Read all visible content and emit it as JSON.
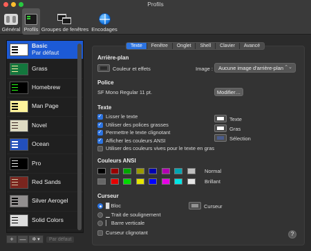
{
  "window": {
    "title": "Profils"
  },
  "toolbar": {
    "items": [
      {
        "label": "Général",
        "icon": "switch-icon"
      },
      {
        "label": "Profils",
        "icon": "terminal-icon"
      },
      {
        "label": "Groupes de fenêtres",
        "icon": "window-group-icon"
      },
      {
        "label": "Encodages",
        "icon": "globe-icon"
      }
    ]
  },
  "profiles": [
    {
      "name": "Basic",
      "subtitle": "Par défaut",
      "thumb_bg": "#ffffff",
      "thumb_fg": "#000000",
      "selected": true
    },
    {
      "name": "Grass",
      "thumb_bg": "#13773d",
      "thumb_fg": "#fff0a5"
    },
    {
      "name": "Homebrew",
      "thumb_bg": "#000000",
      "thumb_fg": "#28fe14"
    },
    {
      "name": "Man Page",
      "thumb_bg": "#fef49c",
      "thumb_fg": "#000000"
    },
    {
      "name": "Novel",
      "thumb_bg": "#dfdbc3",
      "thumb_fg": "#3b2322"
    },
    {
      "name": "Ocean",
      "thumb_bg": "#224fbc",
      "thumb_fg": "#ffffff"
    },
    {
      "name": "Pro",
      "thumb_bg": "#000000",
      "thumb_fg": "#f2f2f2"
    },
    {
      "name": "Red Sands",
      "thumb_bg": "#7a251e",
      "thumb_fg": "#d7c9a7"
    },
    {
      "name": "Silver Aerogel",
      "thumb_bg": "#928f8f",
      "thumb_fg": "#000000"
    },
    {
      "name": "Solid Colors",
      "thumb_bg": "#dddddd",
      "thumb_fg": "#000000"
    }
  ],
  "sidebar_tools": {
    "add": "+",
    "remove": "—",
    "gear": "✲ ▾",
    "default": "Par défaut"
  },
  "tabs": [
    {
      "label": "Texte",
      "active": true
    },
    {
      "label": "Fenêtre"
    },
    {
      "label": "Onglet"
    },
    {
      "label": "Shell"
    },
    {
      "label": "Clavier"
    },
    {
      "label": "Avancé"
    }
  ],
  "background": {
    "title": "Arrière-plan",
    "color_label": "Couleur et effets",
    "color": "#2b2b2b",
    "image_label": "Image :",
    "image_value": "Aucune image d'arrière-plan",
    "arrow": "⌃⌄"
  },
  "font": {
    "title": "Police",
    "value": "SF Mono Regular 11 pt.",
    "modify_label": "Modifier…"
  },
  "text": {
    "title": "Texte",
    "options": [
      {
        "label": "Lisser le texte",
        "checked": true
      },
      {
        "label": "Utiliser des polices grasses",
        "checked": true
      },
      {
        "label": "Permettre le texte clignotant",
        "checked": true
      },
      {
        "label": "Afficher les couleurs ANSI",
        "checked": true
      },
      {
        "label": "Utiliser des couleurs vives pour le texte en gras",
        "checked": false
      }
    ],
    "colors": [
      {
        "label": "Texte",
        "color": "#ffffff"
      },
      {
        "label": "Gras",
        "color": "#ffffff"
      },
      {
        "label": "Sélection",
        "color": "#4a5c8c"
      }
    ]
  },
  "ansi": {
    "title": "Couleurs ANSI",
    "normal_label": "Normal",
    "bright_label": "Brillant",
    "normal": [
      "#000000",
      "#990000",
      "#00a600",
      "#999900",
      "#0000b2",
      "#b200b2",
      "#00a6b2",
      "#bfbfbf"
    ],
    "bright": [
      "#666666",
      "#e50000",
      "#00d900",
      "#e5e500",
      "#0000ff",
      "#e500e5",
      "#00e5e5",
      "#e5e5e5"
    ]
  },
  "cursor": {
    "title": "Curseur",
    "options": [
      {
        "label": "█ Bloc",
        "checked": true
      },
      {
        "label": "▁ Trait de soulignement",
        "checked": false
      },
      {
        "label": "▏ Barre verticale",
        "checked": false
      }
    ],
    "color_label": "Curseur",
    "color": "#939393",
    "blink_label": "Curseur clignotant",
    "blink": false
  },
  "help": "?"
}
